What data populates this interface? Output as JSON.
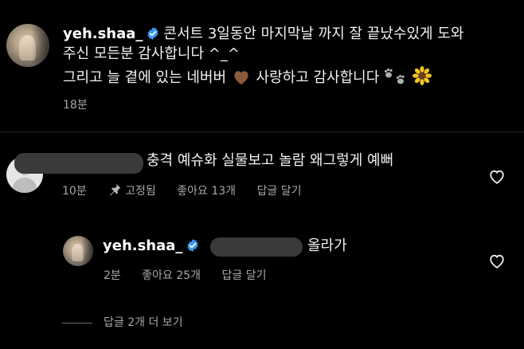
{
  "post": {
    "username": "yeh.shaa_",
    "caption_line1": "콘서트 3일동안 마지막날 까지 잘 끝났수있게 도와",
    "caption_line2": "주신 모든분 감사합니다 ^_^",
    "caption_line3_a": "그리고 늘 곁에 있는 네버버",
    "caption_line3_b": "사랑하고 감사합니다",
    "time": "18분"
  },
  "comment": {
    "text": "충격 예슈화 실물보고 놀람 왜그렇게 예뻐",
    "time": "10분",
    "pinned_label": "고정됨",
    "likes_label": "좋아요 13개",
    "reply_label": "답글 달기"
  },
  "reply": {
    "username": "yeh.shaa_",
    "text": "올라가",
    "time": "2분",
    "likes_label": "좋아요 25개",
    "reply_label": "답글 달기"
  },
  "more_replies_label": "답글 2개 더 보기",
  "icons": {
    "verified": "verified-badge-icon",
    "heart_emoji": "brown-heart-emoji",
    "paw_emoji": "paw-prints-emoji",
    "sunflower_emoji": "sunflower-emoji",
    "pin": "pin-icon",
    "like": "heart-outline-icon"
  },
  "colors": {
    "background": "#000000",
    "text": "#f5f5f5",
    "secondary_text": "#a8a8a8",
    "verified_blue": "#3897f0",
    "brown_heart": "#8b5a3c"
  }
}
